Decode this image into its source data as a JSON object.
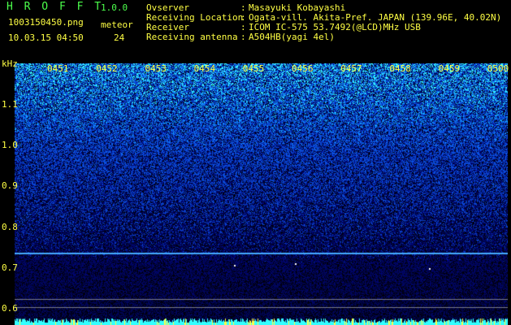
{
  "header": {
    "app_title": "H R O F F T",
    "app_version": "1.0.0",
    "filename": "1003150450.png",
    "meteor_label": "meteor",
    "timestamp": "10.03.15 04:50",
    "meteor_count": "24"
  },
  "info": [
    {
      "label": "Ovserver",
      "value": "Masayuki Kobayashi"
    },
    {
      "label": "Receiving Location",
      "value": "Ogata-vill. Akita-Pref. JAPAN (139.96E, 40.02N)"
    },
    {
      "label": "Receiver",
      "value": "ICOM IC-575 53.7492(@LCD)MHz USB"
    },
    {
      "label": "Receiving antenna",
      "value": "A504HB(yagi 4el)"
    }
  ],
  "info_colon": ":",
  "axis": {
    "y_unit": "kHz",
    "y_ticks": [
      {
        "label": "1.1",
        "value": 1.1
      },
      {
        "label": "1.0",
        "value": 1.0
      },
      {
        "label": "0.9",
        "value": 0.9
      },
      {
        "label": "0.8",
        "value": 0.8
      },
      {
        "label": "0.7",
        "value": 0.7
      },
      {
        "label": "0.6",
        "value": 0.6
      }
    ],
    "time_labels": [
      "0451",
      "0452",
      "0453",
      "0454",
      "0455",
      "0456",
      "0457",
      "0458",
      "0459",
      "0500"
    ]
  },
  "colors": {
    "label": "#ffff44",
    "title": "#4cff4c",
    "background": "#000000",
    "noise_blue": "#1a3cff",
    "noise_cyan": "#33ffff",
    "carrier": "#44aaff"
  }
}
